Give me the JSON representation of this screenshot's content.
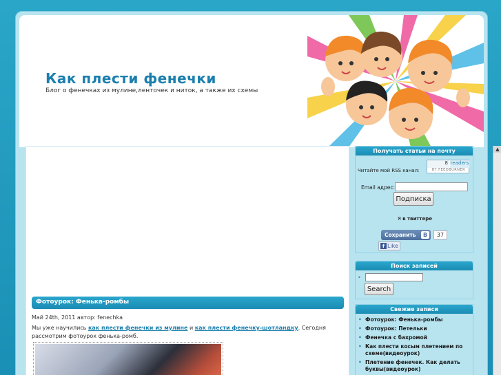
{
  "site": {
    "title": "Как плести фенечки",
    "description": "Блог о фенечках из мулине,ленточек и ниток, а также их схемы"
  },
  "post": {
    "title": "Фотоурок: Фенька-ромбы",
    "meta": "Май 24th, 2011 автор: fenechka",
    "text_before": "Мы уже научились ",
    "link1": "как плести фенечки из мулине",
    "text_mid": " и ",
    "link2": "как плести фенечку-шотландку",
    "text_after": ". Сегодня рассмотрим фотоурок фенька-ромб."
  },
  "subscribe_widget": {
    "title": "Получать статьи на почту",
    "feedburner_count": "8",
    "feedburner_readers": "readers",
    "feedburner_by": "BY FEEDBURNER",
    "rss_label": "Читайте мой RSS канал:",
    "email_label": "Email адрес:",
    "email_value": "",
    "subscribe_button": "Подписка",
    "twitter_prefix": "Я",
    "twitter_link": "в твиттере",
    "vk_button": "Сохранить",
    "vk_logo": "В",
    "vk_count": "37",
    "fb_like": "Like"
  },
  "search_widget": {
    "title": "Поиск записей",
    "search_value": "",
    "search_button": "Search"
  },
  "recent_widget": {
    "title": "Свежие записи",
    "items": [
      "Фотоурок: Фенька-ромбы",
      "Фотоурок: Петельки",
      "Фенечка с бахромой",
      "Как плести косым плетением по схеме(видеоурок)",
      "Плетение фенечек. Как делать буквы(видеоурок)"
    ]
  },
  "colors": {
    "accent": "#1a7fae",
    "widget_bar": "#1b8cb4",
    "sidebar_bg": "#b8e4f0",
    "page_bg": "#2aa6c8"
  },
  "icons": [
    "kids-illustration",
    "feedburner-icon",
    "vk-icon",
    "facebook-icon",
    "scroll-up-arrow-icon"
  ]
}
